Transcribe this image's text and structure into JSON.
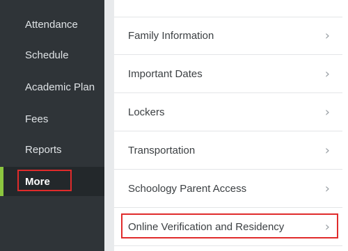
{
  "sidebar": {
    "items": [
      {
        "label": "Attendance"
      },
      {
        "label": "Schedule"
      },
      {
        "label": "Academic Plan"
      },
      {
        "label": "Fees"
      },
      {
        "label": "Reports"
      },
      {
        "label": "More"
      }
    ],
    "active_item": "More",
    "accent_color": "#8cc63f"
  },
  "menu": {
    "items": [
      {
        "label": "Family Information"
      },
      {
        "label": "Important Dates"
      },
      {
        "label": "Lockers"
      },
      {
        "label": "Transportation"
      },
      {
        "label": "Schoology Parent Access"
      },
      {
        "label": "Online Verification and Residency"
      }
    ],
    "chevron": "›",
    "chevron_icon": "chevron-right-icon"
  },
  "annotation": {
    "highlight_color": "#e02b2b",
    "highlighted_items": [
      "More",
      "Online Verification and Residency"
    ]
  }
}
